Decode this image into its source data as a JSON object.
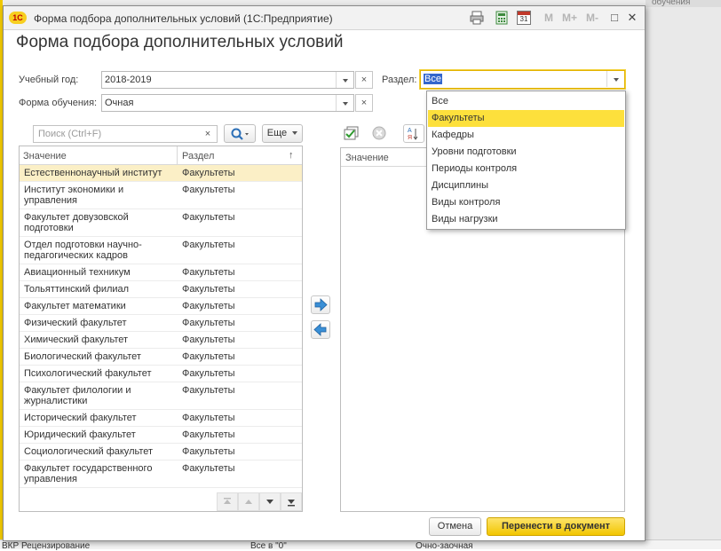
{
  "background": {
    "right_header_text": "обучения",
    "bottom_cells": [
      "ВКР Рецензирование",
      "Все в \"0\"",
      "Очно-заочная"
    ]
  },
  "window": {
    "logo_text": "1С",
    "title": "Форма подбора дополнительных условий  (1С:Предприятие)",
    "toolbar": {
      "m": "M",
      "m_plus": "M+",
      "m_minus": "M-",
      "calendar_day": "31"
    },
    "controls": {
      "restore": "□",
      "close": "✕"
    }
  },
  "form": {
    "heading": "Форма подбора дополнительных условий",
    "academic_year": {
      "label": "Учебный год:",
      "value": "2018-2019"
    },
    "study_form": {
      "label": "Форма обучения:",
      "value": "Очная"
    },
    "section": {
      "label": "Раздел:",
      "value": "Все"
    },
    "clear_symbol": "×"
  },
  "search": {
    "placeholder": "Поиск (Ctrl+F)",
    "clear_symbol": "×",
    "more_label": "Еще"
  },
  "left_table": {
    "columns": [
      "Значение",
      "Раздел"
    ],
    "sort_symbol": "↑",
    "rows": [
      {
        "value": "Естественнонаучный институт",
        "section": "Факультеты"
      },
      {
        "value": "Институт экономики и управления",
        "section": "Факультеты"
      },
      {
        "value": "Факультет довузовской подготовки",
        "section": "Факультеты"
      },
      {
        "value": "Отдел подготовки научно-педагогических кадров",
        "section": "Факультеты"
      },
      {
        "value": "Авиационный техникум",
        "section": "Факультеты"
      },
      {
        "value": "Тольяттинский филиал",
        "section": "Факультеты"
      },
      {
        "value": "Факультет математики",
        "section": "Факультеты"
      },
      {
        "value": "Физический факультет",
        "section": "Факультеты"
      },
      {
        "value": "Химический факультет",
        "section": "Факультеты"
      },
      {
        "value": "Биологический факультет",
        "section": "Факультеты"
      },
      {
        "value": "Психологический факультет",
        "section": "Факультеты"
      },
      {
        "value": "Факультет филологии и журналистики",
        "section": "Факультеты"
      },
      {
        "value": "Исторический факультет",
        "section": "Факультеты"
      },
      {
        "value": "Юридический факультет",
        "section": "Факультеты"
      },
      {
        "value": "Социологический факультет",
        "section": "Факультеты"
      },
      {
        "value": "Факультет государственного управления",
        "section": "Факультеты"
      }
    ]
  },
  "right_table": {
    "columns": [
      "Значение"
    ]
  },
  "dropdown": {
    "items": [
      "Все",
      "Факультеты",
      "Кафедры",
      "Уровни подготовки",
      "Периоды контроля",
      "Дисциплины",
      "Виды контроля",
      "Виды нагрузки"
    ],
    "highlighted_index": 1
  },
  "buttons": {
    "cancel": "Отмена",
    "transfer": "Перенести в документ"
  },
  "colors": {
    "accent": "#f2c600",
    "highlight": "#fde03c",
    "selected_row": "#fbefc6"
  }
}
